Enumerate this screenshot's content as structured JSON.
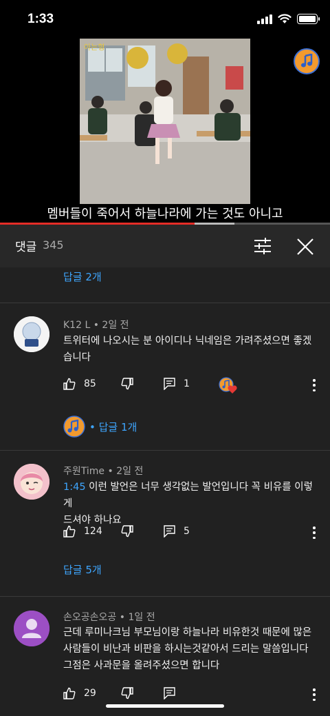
{
  "status": {
    "time": "1:33"
  },
  "video": {
    "subtitle": "멤버들이 죽어서 하늘나라에 가는 것도 아니고",
    "progress": 0.59,
    "buffered": 0.12
  },
  "comments_panel": {
    "title": "댓글",
    "count": "345"
  },
  "top_replies_label": "답글 2개",
  "comments": [
    {
      "author": "K12 L",
      "age": "2일 전",
      "text_line1": "트위터에 나오시는 분 아이디나 닉네임은 가려주셨으면 좋겠",
      "text_line2": "습니다",
      "likes": "85",
      "reply_count": "1",
      "replies_label": "• 답글 1개"
    },
    {
      "author": "주원Time",
      "age": "2일 전",
      "timestamp": "1:45",
      "text_line1": " 이런 발언은 너무 생각없는 발언입니다 꼭 비유를 이렇게",
      "text_line2": "드셔야 하나요",
      "likes": "124",
      "reply_count": "5",
      "replies_label": "답글 5개"
    },
    {
      "author": "손오공손오공",
      "age": "1일 전",
      "text_line1": "근데 루미나크님 부모님이랑 하늘나라 비유한것 때문에 많은",
      "text_line2": "사람들이 비난과 비판을 하시는것같아서 드리는 말씀입니다",
      "text_line3": "그점은 사과문을 올려주셨으면 합니다",
      "likes": "29"
    }
  ],
  "meta_separator": " • ",
  "colors": {
    "link": "#3ea6ff",
    "progress_played": "#e52d27",
    "background": "#212121",
    "header_bg": "#282828",
    "channel_badge": "#f29a2e"
  }
}
